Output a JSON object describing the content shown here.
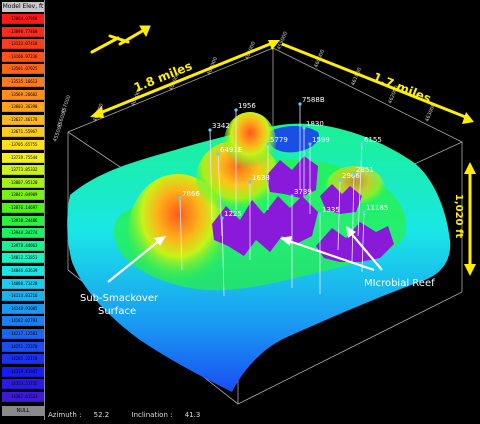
{
  "legend": {
    "title": "Model Elev, ft",
    "null_label": "NULL",
    "entries": [
      {
        "label": "-13064.07958",
        "color": "#ff1a1a"
      },
      {
        "label": "-13098.77460",
        "color": "#ff2a1a"
      },
      {
        "label": "-13133.07418",
        "color": "#ff3d1a"
      },
      {
        "label": "-13166.97236",
        "color": "#ff521a"
      },
      {
        "label": "-13501.07025",
        "color": "#ff661a"
      },
      {
        "label": "-13535.16613",
        "color": "#ff7a1a"
      },
      {
        "label": "-13569.26602",
        "color": "#ff8f1a"
      },
      {
        "label": "-13603.36390",
        "color": "#ffa31a"
      },
      {
        "label": "-13637.46178",
        "color": "#ffb81a"
      },
      {
        "label": "-13671.55967",
        "color": "#ffcc1a"
      },
      {
        "label": "-13705.65755",
        "color": "#ffe01a"
      },
      {
        "label": "-13739.75544",
        "color": "#f2f21a"
      },
      {
        "label": "-13773.85332",
        "color": "#ccf21a"
      },
      {
        "label": "-13807.95120",
        "color": "#a3f21a"
      },
      {
        "label": "-13842.04909",
        "color": "#7af21a"
      },
      {
        "label": "-13876.14697",
        "color": "#4df21a"
      },
      {
        "label": "-13910.24486",
        "color": "#2af23d"
      },
      {
        "label": "-13944.34274",
        "color": "#1af266"
      },
      {
        "label": "-13978.44063",
        "color": "#1af291"
      },
      {
        "label": "-14012.53851",
        "color": "#1af2bf"
      },
      {
        "label": "-14046.63639",
        "color": "#1ae6e6"
      },
      {
        "label": "-14080.73428",
        "color": "#1accf2"
      },
      {
        "label": "-14114.83216",
        "color": "#1ab3f2"
      },
      {
        "label": "-14148.93005",
        "color": "#1a99f2"
      },
      {
        "label": "-14182.02793",
        "color": "#1a80f2"
      },
      {
        "label": "-14217.12581",
        "color": "#1a66f2"
      },
      {
        "label": "-14251.22370",
        "color": "#1a4df2"
      },
      {
        "label": "-14285.32158",
        "color": "#1a33f2"
      },
      {
        "label": "-14319.41947",
        "color": "#1a1af2"
      },
      {
        "label": "-14353.51735",
        "color": "#2a1ae6"
      },
      {
        "label": "-14387.61523",
        "color": "#3d1ad9"
      }
    ]
  },
  "annotations": {
    "width_label": "1.8 miles",
    "depth_label": "1.7 miles",
    "height_label": "1,020 ft",
    "surface_label_line1": "Sub-Smackover",
    "surface_label_line2": "Surface",
    "reef_label": "MIcrobial Reef"
  },
  "wells": [
    "1956",
    "7588B",
    "3342",
    "1830",
    "6491E",
    "5779",
    "1599",
    "6155",
    "1638",
    "2966",
    "3739",
    "2851",
    "11185",
    "7866",
    "1225",
    "1335"
  ],
  "axis_ticks": {
    "top_x": [
      "400000",
      "401000",
      "402000",
      "403000",
      "404000"
    ],
    "left_y": [
      "455000",
      "456000",
      "457000"
    ],
    "right_y": [
      "459000",
      "460000",
      "461000",
      "462000",
      "463000"
    ]
  },
  "status": {
    "azimuth_label": "Azimuth :",
    "azimuth_value": "52.2",
    "inclination_label": "Inclination :",
    "inclination_value": "41.3"
  }
}
